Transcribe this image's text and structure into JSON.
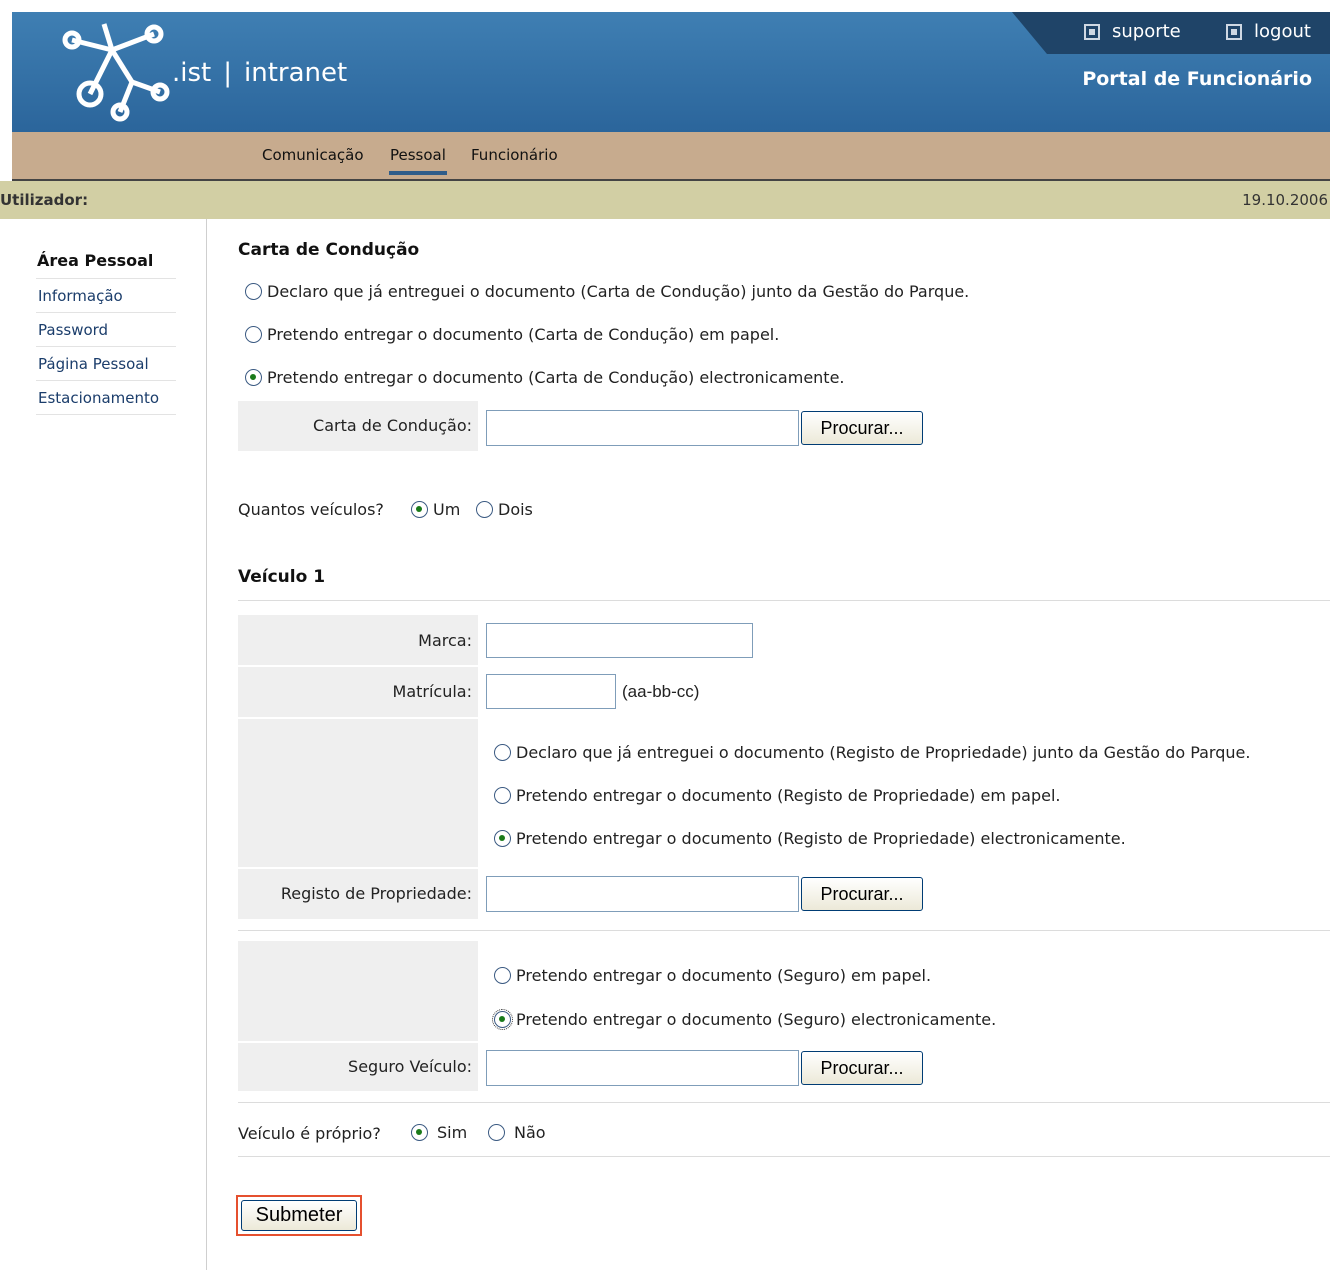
{
  "header": {
    "brand_suffix": ".ist",
    "separator": "|",
    "brand_name": "intranet",
    "portal_title": "Portal de Funcionário",
    "suporte_label": "suporte",
    "logout_label": "logout",
    "colors": {
      "header_blue": "#2b659b",
      "nav_tan": "#c7ab8e",
      "userbar_olive": "#d2cfa4"
    }
  },
  "nav": {
    "items": [
      {
        "label": "Comunicação"
      },
      {
        "label": "Pessoal",
        "active": true
      },
      {
        "label": "Funcionário"
      }
    ]
  },
  "userbar": {
    "label": "Utilizador:",
    "date": "19.10.2006"
  },
  "sidebar": {
    "title": "Área Pessoal",
    "items": [
      {
        "label": "Informação"
      },
      {
        "label": "Password"
      },
      {
        "label": "Página Pessoal"
      },
      {
        "label": "Estacionamento"
      }
    ]
  },
  "carta": {
    "heading": "Carta de Condução",
    "options": [
      "Declaro que já entreguei o documento (Carta de Condução) junto da Gestão do Parque.",
      "Pretendo entregar o documento (Carta de Condução) em papel.",
      "Pretendo entregar o documento (Carta de Condução) electronicamente."
    ],
    "selected_index": 2,
    "file_label": "Carta de Condução:",
    "browse_label": "Procurar..."
  },
  "vehicles_count": {
    "question": "Quantos veículos?",
    "options": [
      "Um",
      "Dois"
    ],
    "selected": "Um"
  },
  "vehicle1": {
    "heading": "Veículo 1",
    "marca_label": "Marca:",
    "marca_value": "",
    "matricula_label": "Matrícula:",
    "matricula_value": "",
    "matricula_hint": "(aa-bb-cc)",
    "registo_options": [
      "Declaro que já entreguei o documento (Registo de Propriedade) junto da Gestão do Parque.",
      "Pretendo entregar o documento (Registo de Propriedade) em papel.",
      "Pretendo entregar o documento (Registo de Propriedade) electronicamente."
    ],
    "registo_selected_index": 2,
    "registo_label": "Registo de Propriedade:",
    "seguro_options": [
      "Pretendo entregar o documento (Seguro) em papel.",
      "Pretendo entregar o documento (Seguro) electronicamente."
    ],
    "seguro_selected_index": 1,
    "seguro_label": "Seguro Veículo:",
    "browse_label": "Procurar...",
    "proprio_question": "Veículo é próprio?",
    "proprio_options": [
      "Sim",
      "Não"
    ],
    "proprio_selected": "Sim"
  },
  "submit_label": "Submeter"
}
